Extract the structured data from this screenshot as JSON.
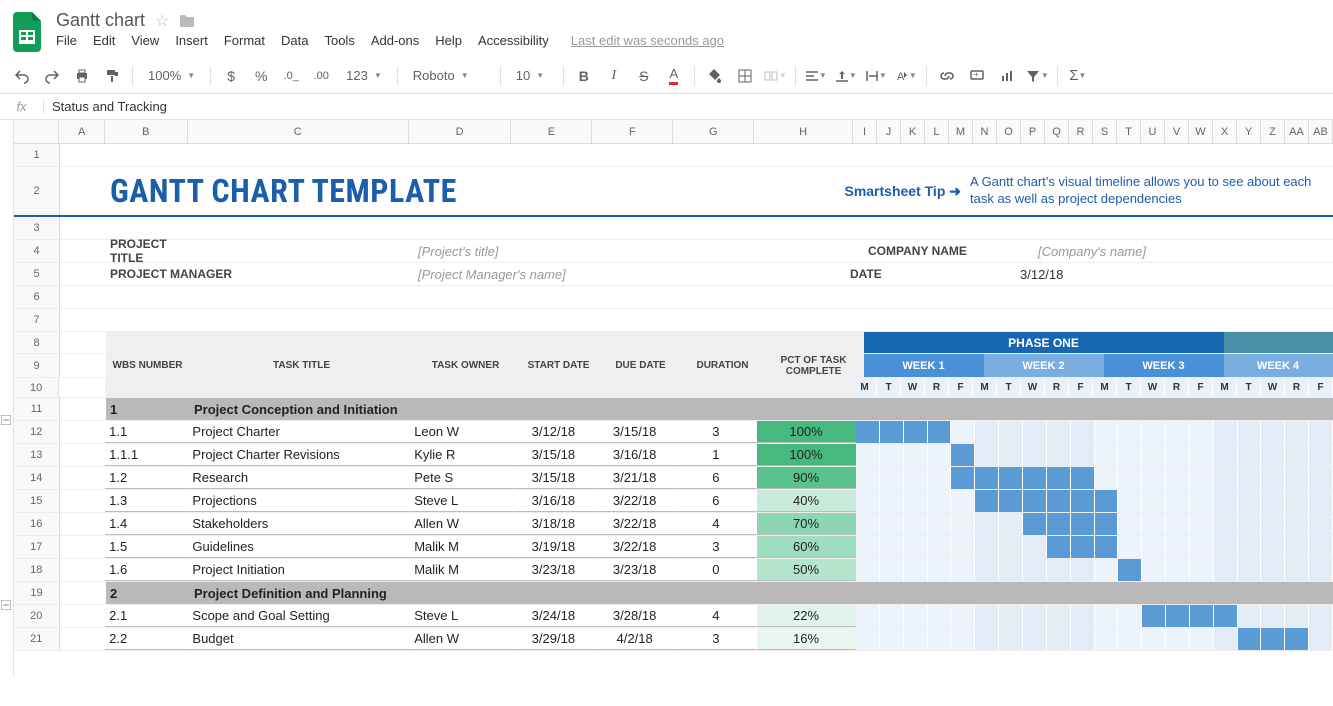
{
  "doc": {
    "title": "Gantt chart",
    "last_edit": "Last edit was seconds ago"
  },
  "menu": [
    "File",
    "Edit",
    "View",
    "Insert",
    "Format",
    "Data",
    "Tools",
    "Add-ons",
    "Help",
    "Accessibility"
  ],
  "toolbar": {
    "zoom": "100%",
    "font": "Roboto",
    "size": "10"
  },
  "formula": {
    "value": "Status and Tracking"
  },
  "cols_main": [
    "A",
    "B",
    "C",
    "D",
    "E",
    "F",
    "G",
    "H"
  ],
  "cols_days": [
    "I",
    "J",
    "K",
    "L",
    "M",
    "N",
    "O",
    "P",
    "Q",
    "R",
    "S",
    "T",
    "U",
    "V",
    "W",
    "X",
    "Y",
    "Z",
    "AA",
    "AB"
  ],
  "row_nums": [
    "1",
    "2",
    "3",
    "4",
    "5",
    "6",
    "7",
    "8",
    "9",
    "10",
    "11",
    "12",
    "13",
    "14",
    "15",
    "16",
    "17",
    "18",
    "19",
    "20",
    "21"
  ],
  "content": {
    "title": "GANTT CHART TEMPLATE",
    "tip_label": "Smartsheet Tip ➜",
    "tip_body": "A Gantt chart's visual timeline allows you to see about each task as well as project dependencies",
    "meta": {
      "project_title_label": "PROJECT TITLE",
      "project_title_value": "[Project's title]",
      "company_label": "COMPANY NAME",
      "company_value": "[Company's name]",
      "pm_label": "PROJECT MANAGER",
      "pm_value": "[Project Manager's name]",
      "date_label": "DATE",
      "date_value": "3/12/18"
    },
    "col_headers": {
      "wbs": "WBS NUMBER",
      "task": "TASK TITLE",
      "owner": "TASK OWNER",
      "start": "START DATE",
      "due": "DUE DATE",
      "dur": "DURATION",
      "pct": "PCT OF TASK COMPLETE"
    },
    "phase": "PHASE ONE",
    "weeks": [
      "WEEK 1",
      "WEEK 2",
      "WEEK 3",
      "WEEK 4"
    ],
    "days": [
      "M",
      "T",
      "W",
      "R",
      "F",
      "M",
      "T",
      "W",
      "R",
      "F",
      "M",
      "T",
      "W",
      "R",
      "F",
      "M",
      "T",
      "W",
      "R",
      "F"
    ],
    "sections": {
      "s1_num": "1",
      "s1_title": "Project Conception and Initiation",
      "s2_num": "2",
      "s2_title": "Project Definition and Planning"
    },
    "rows": [
      {
        "wbs": "1.1",
        "task": "Project Charter",
        "owner": "Leon W",
        "start": "3/12/18",
        "due": "3/15/18",
        "dur": "3",
        "pct": "100%",
        "pctc": "#48b97e",
        "bar": [
          0,
          1,
          2,
          3
        ]
      },
      {
        "wbs": "1.1.1",
        "task": "Project Charter Revisions",
        "owner": "Kylie R",
        "start": "3/15/18",
        "due": "3/16/18",
        "dur": "1",
        "pct": "100%",
        "pctc": "#48b97e",
        "bar": [
          4
        ]
      },
      {
        "wbs": "1.2",
        "task": "Research",
        "owner": "Pete S",
        "start": "3/15/18",
        "due": "3/21/18",
        "dur": "6",
        "pct": "90%",
        "pctc": "#59c28d",
        "bar": [
          4,
          5,
          6,
          7,
          8,
          9
        ]
      },
      {
        "wbs": "1.3",
        "task": "Projections",
        "owner": "Steve L",
        "start": "3/16/18",
        "due": "3/22/18",
        "dur": "6",
        "pct": "40%",
        "pctc": "#c9eadb",
        "bar": [
          5,
          6,
          7,
          8,
          9,
          10
        ]
      },
      {
        "wbs": "1.4",
        "task": "Stakeholders",
        "owner": "Allen W",
        "start": "3/18/18",
        "due": "3/22/18",
        "dur": "4",
        "pct": "70%",
        "pctc": "#8dd6b4",
        "bar": [
          7,
          8,
          9,
          10
        ]
      },
      {
        "wbs": "1.5",
        "task": "Guidelines",
        "owner": "Malik M",
        "start": "3/19/18",
        "due": "3/22/18",
        "dur": "3",
        "pct": "60%",
        "pctc": "#9eddc0",
        "bar": [
          8,
          9,
          10
        ]
      },
      {
        "wbs": "1.6",
        "task": "Project Initiation",
        "owner": "Malik M",
        "start": "3/23/18",
        "due": "3/23/18",
        "dur": "0",
        "pct": "50%",
        "pctc": "#b5e4cd",
        "bar": [
          11
        ]
      },
      {
        "wbs": "2.1",
        "task": "Scope and Goal Setting",
        "owner": "Steve L",
        "start": "3/24/18",
        "due": "3/28/18",
        "dur": "4",
        "pct": "22%",
        "pctc": "#e1f3ea",
        "bar": [
          12,
          13,
          14,
          15
        ]
      },
      {
        "wbs": "2.2",
        "task": "Budget",
        "owner": "Allen W",
        "start": "3/29/18",
        "due": "4/2/18",
        "dur": "3",
        "pct": "16%",
        "pctc": "#e9f6ef",
        "bar": [
          16,
          17,
          18
        ]
      }
    ]
  }
}
